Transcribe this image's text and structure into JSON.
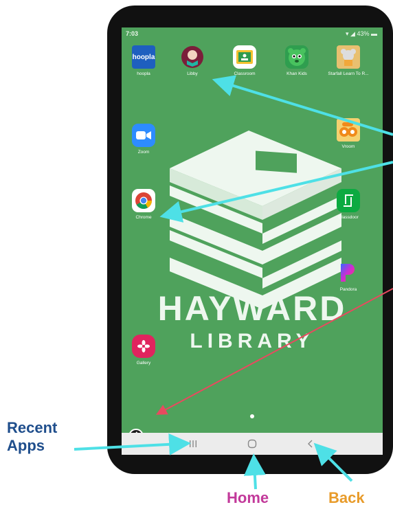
{
  "status_bar": {
    "time": "7:03",
    "battery": "43%"
  },
  "apps": [
    {
      "label": "hoopla",
      "icon": "hoopla-icon",
      "tile_text": "hoopla",
      "color": "#1e5fbf"
    },
    {
      "label": "Libby",
      "icon": "libby-icon",
      "color": "#7b1e3a"
    },
    {
      "label": "Classroom",
      "icon": "classroom-icon",
      "color": "#f2c230"
    },
    {
      "label": "Khan Kids",
      "icon": "khan-kids-icon",
      "color": "#2f9e4f"
    },
    {
      "label": "Starfall Learn To R...",
      "icon": "starfall-icon",
      "color": "#d9a441"
    },
    {
      "label": "Zoom",
      "icon": "zoom-icon",
      "color": "#2d8cff"
    },
    {
      "label": "Vroom",
      "icon": "vroom-icon",
      "color": "#f0a21a"
    },
    {
      "label": "Chrome",
      "icon": "chrome-icon",
      "color": "#ffffff"
    },
    {
      "label": "Glassdoor",
      "icon": "glassdoor-icon",
      "color": "#0caa41"
    },
    {
      "label": "Pandora",
      "icon": "pandora-icon",
      "color": "#ffffff"
    },
    {
      "label": "Gallery",
      "icon": "gallery-icon",
      "color": "#e0245e"
    }
  ],
  "wallpaper": {
    "line1": "HAYWARD",
    "line2": "LIBRARY"
  },
  "nav": {
    "recent_icon": "recent-apps-icon",
    "home_icon": "home-icon",
    "back_icon": "back-icon"
  },
  "callouts": {
    "recent": "Recent Apps",
    "home": "Home",
    "back": "Back",
    "recent_color": "#1f4e8c",
    "home_color": "#c2399a",
    "back_color": "#e89b2a",
    "arrow_color": "#4ee0e6",
    "info_arrow_color": "#e84a5f"
  }
}
